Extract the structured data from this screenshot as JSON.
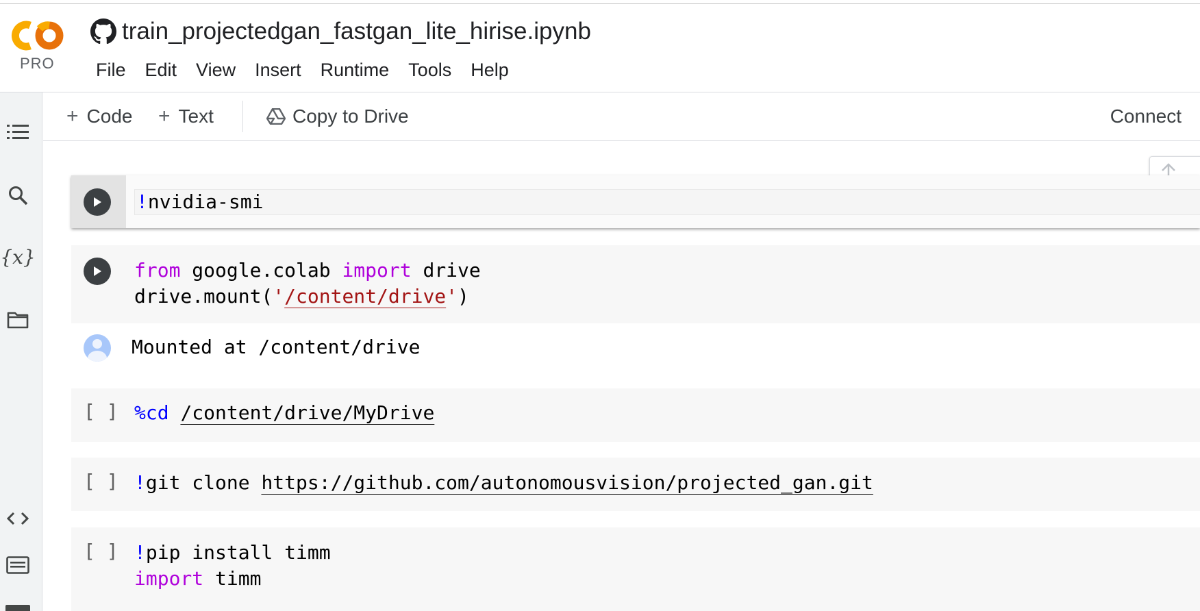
{
  "app": {
    "logo_text": "CO",
    "plan_badge": "PRO",
    "notebook_title": "train_projectedgan_fastgan_lite_hirise.ipynb"
  },
  "menu": {
    "items": [
      "File",
      "Edit",
      "View",
      "Insert",
      "Runtime",
      "Tools",
      "Help"
    ]
  },
  "toolbar": {
    "add_code_label": "Code",
    "add_text_label": "Text",
    "copy_to_drive_label": "Copy to Drive",
    "connect_label": "Connect"
  },
  "sidebar": {
    "icons": [
      "table-of-contents-icon",
      "search-icon",
      "variables-icon",
      "files-icon",
      "code-snippets-icon",
      "command-palette-icon"
    ],
    "variables_glyph": "{x}"
  },
  "cells": [
    {
      "state": "run-button",
      "lines": [
        [
          {
            "t": "!",
            "c": "blue"
          },
          {
            "t": "nvidia-smi"
          }
        ]
      ]
    },
    {
      "state": "run-button",
      "lines": [
        [
          {
            "t": "from",
            "c": "purple"
          },
          {
            "t": " google.colab "
          },
          {
            "t": "import",
            "c": "purple"
          },
          {
            "t": " drive"
          }
        ],
        [
          {
            "t": "drive.mount("
          },
          {
            "t": "'",
            "c": "red"
          },
          {
            "t": "/content/drive",
            "c": "red",
            "u": true
          },
          {
            "t": "'",
            "c": "red"
          },
          {
            "t": ")"
          }
        ]
      ],
      "output": "Mounted at /content/drive"
    },
    {
      "state": "not-run",
      "bracket": "[ ]",
      "lines": [
        [
          {
            "t": "%cd",
            "c": "blue"
          },
          {
            "t": " "
          },
          {
            "t": "/content/drive/MyDrive",
            "u": true
          }
        ]
      ]
    },
    {
      "state": "not-run",
      "bracket": "[ ]",
      "lines": [
        [
          {
            "t": "!",
            "c": "blue"
          },
          {
            "t": "git clone "
          },
          {
            "t": "https://github.com/autonomousvision/projected_gan.git",
            "u": true
          }
        ]
      ]
    },
    {
      "state": "not-run",
      "bracket": "[ ]",
      "lines": [
        [
          {
            "t": "!",
            "c": "blue"
          },
          {
            "t": "pip install timm"
          }
        ],
        [
          {
            "t": "import",
            "c": "purple"
          },
          {
            "t": " timm"
          }
        ]
      ]
    }
  ],
  "colors": {
    "keyword_purple": "#af00db",
    "magic_blue": "#0000ff",
    "string_red": "#a31515",
    "logo_orange": "#f9ab00",
    "logo_dark_orange": "#e8710a"
  }
}
